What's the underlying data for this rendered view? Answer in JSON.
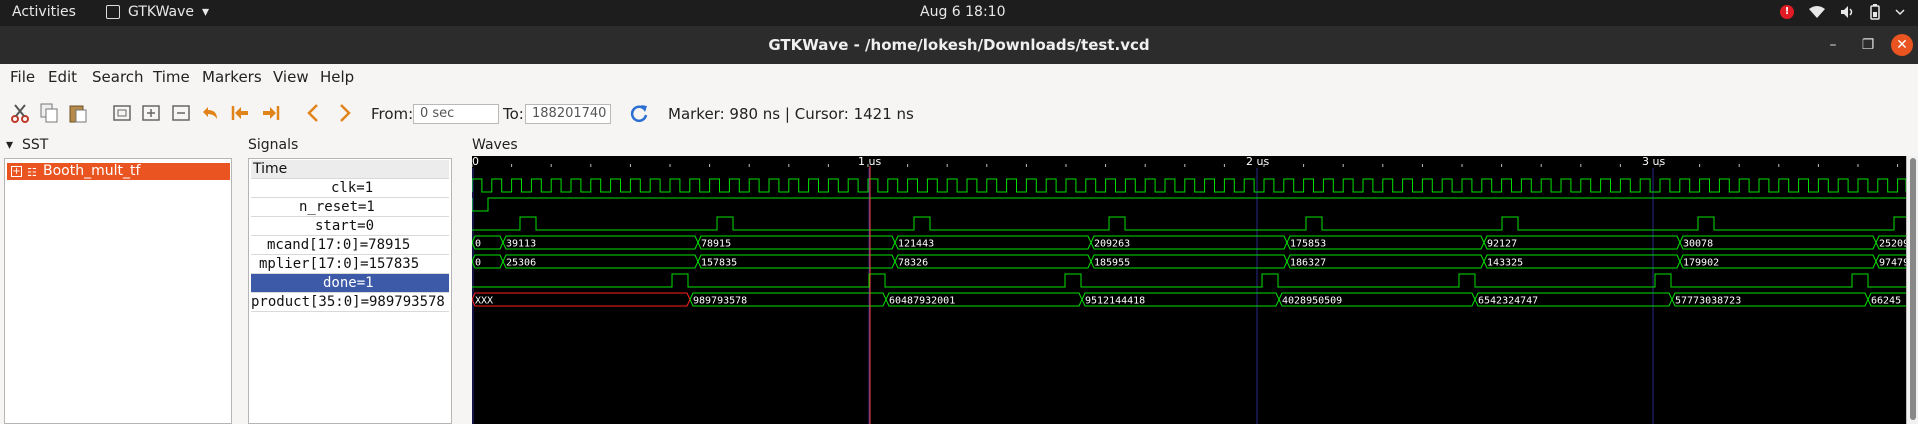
{
  "topbar": {
    "activities": "Activities",
    "app": "GTKWave",
    "app_arrow": "▾",
    "clock": "Aug 6  18:10",
    "notice": "!"
  },
  "window": {
    "title": "GTKWave - /home/lokesh/Downloads/test.vcd",
    "min": "–",
    "max": "❐",
    "close": "✕"
  },
  "menu": [
    "File",
    "Edit",
    "Search",
    "Time",
    "Markers",
    "View",
    "Help"
  ],
  "toolbar": {
    "from_label": "From:",
    "from_value": "0 sec",
    "to_label": "To:",
    "to_value": "188201740",
    "marker_text": "Marker: 980 ns  |  Cursor: 1421 ns"
  },
  "sst": {
    "label": "SST",
    "item": "Booth_mult_tf"
  },
  "signals": {
    "label": "Signals",
    "rows": [
      "Time",
      "clk=1",
      "n_reset=1",
      "start=0",
      "mcand[17:0]=78915",
      "mplier[17:0]=157835",
      "done=1",
      "product[35:0]=989793578"
    ]
  },
  "waves": {
    "label": "Waves",
    "time_labels": [
      "0",
      "1 us",
      "2 us",
      "3 us"
    ],
    "mcand_values": [
      "0",
      "39113",
      "78915",
      "121443",
      "209263",
      "175853",
      "92127",
      "30078",
      "25209"
    ],
    "mplier_values": [
      "0",
      "25306",
      "157835",
      "78326",
      "185955",
      "186327",
      "143325",
      "179902",
      "97479"
    ],
    "product_values": [
      "XXX",
      "989793578",
      "60487932001",
      "9512144418",
      "4028950509",
      "6542324747",
      "57773038723",
      "66245"
    ],
    "colors": {
      "trace": "#00e000",
      "grid": "#2a2a8a",
      "cursor": "#ff4040",
      "xxx": "#ff2020",
      "text": "#ffffff"
    }
  }
}
